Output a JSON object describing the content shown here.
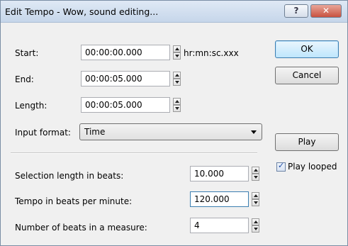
{
  "window": {
    "title": "Edit Tempo - Wow, sound editing...",
    "help_button": "?",
    "close_button": "✕"
  },
  "time_fields": {
    "start": {
      "label": "Start:",
      "value": "00:00:00.000",
      "format_hint": "hr:mn:sc.xxx"
    },
    "end": {
      "label": "End:",
      "value": "00:00:05.000"
    },
    "length": {
      "label": "Length:",
      "value": "00:00:05.000"
    }
  },
  "input_format": {
    "label": "Input format:",
    "selected": "Time"
  },
  "beats": {
    "selection_length": {
      "label": "Selection length in beats:",
      "value": "10.000"
    },
    "tempo": {
      "label": "Tempo in beats per minute:",
      "value": "120.000"
    },
    "beats_per_measure": {
      "label": "Number of beats in a measure:",
      "value": "4"
    }
  },
  "buttons": {
    "ok": "OK",
    "cancel": "Cancel",
    "play": "Play"
  },
  "play_looped": {
    "label": "Play looped",
    "checked": true
  },
  "colors": {
    "title_bar": "#c6d6ea",
    "close_button": "#c8523f",
    "default_button": "#bee6fd"
  },
  "icons": [
    "help-icon",
    "close-icon",
    "spin-up-icon",
    "spin-down-icon",
    "dropdown-caret-icon",
    "checkmark-icon"
  ]
}
